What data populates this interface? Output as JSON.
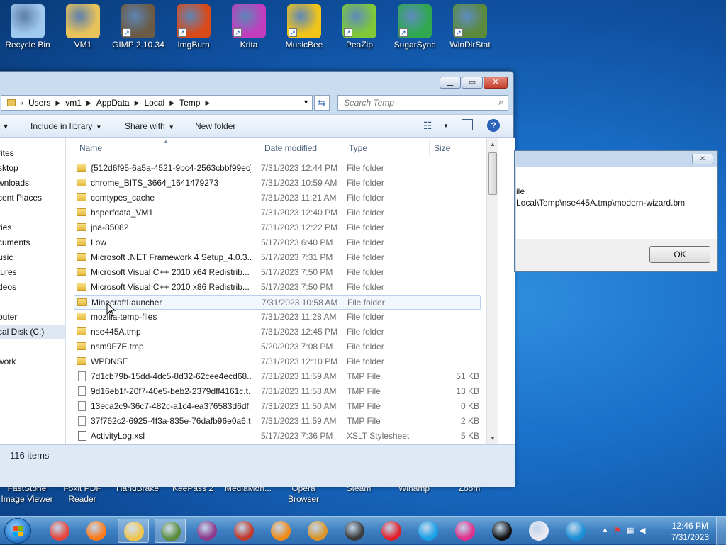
{
  "desktop": {
    "top_icons": [
      {
        "label": "Recycle Bin",
        "icon": "recycle-bin-icon",
        "color": "#9fc9ef"
      },
      {
        "label": "VM1",
        "icon": "user-folder-icon",
        "color": "#e8c25a"
      },
      {
        "label": "GIMP 2.10.34",
        "icon": "gimp-icon",
        "color": "#6b5b45"
      },
      {
        "label": "ImgBurn",
        "icon": "imgburn-icon",
        "color": "#d94a1a"
      },
      {
        "label": "Krita",
        "icon": "krita-icon",
        "color": "#c13dbd"
      },
      {
        "label": "MusicBee",
        "icon": "musicbee-icon",
        "color": "#f0c419"
      },
      {
        "label": "PeaZip",
        "icon": "peazip-icon",
        "color": "#7ec83a"
      },
      {
        "label": "SugarSync",
        "icon": "sugarsync-icon",
        "color": "#2fa84f"
      },
      {
        "label": "WinDirStat",
        "icon": "windirstat-icon",
        "color": "#5a8a3a"
      }
    ],
    "bottom_icons": [
      {
        "label": "FastStone Image Viewer"
      },
      {
        "label": "Foxit PDF Reader"
      },
      {
        "label": "HandBrake"
      },
      {
        "label": "KeePass 2"
      },
      {
        "label": "MediaMon..."
      },
      {
        "label": "Opera Browser"
      },
      {
        "label": "Steam"
      },
      {
        "label": "Winamp"
      },
      {
        "label": "Zoom"
      }
    ]
  },
  "explorer": {
    "breadcrumbs": [
      "Users",
      "vm1",
      "AppData",
      "Local",
      "Temp"
    ],
    "breadcrumb_prefix": "«",
    "search_placeholder": "Search Temp",
    "toolbar": {
      "include_in_library": "Include in library",
      "share_with": "Share with",
      "new_folder": "New folder"
    },
    "nav_items": [
      {
        "label": "rites",
        "selected": false
      },
      {
        "label": "sktop",
        "selected": false
      },
      {
        "label": "wnloads",
        "selected": false
      },
      {
        "label": "cent Places",
        "selected": false
      },
      {
        "label": "ries",
        "selected": false
      },
      {
        "label": "cuments",
        "selected": false
      },
      {
        "label": "usic",
        "selected": false
      },
      {
        "label": "tures",
        "selected": false
      },
      {
        "label": "deos",
        "selected": false
      },
      {
        "label": "puter",
        "selected": false
      },
      {
        "label": "cal Disk (C:)",
        "selected": true
      },
      {
        "label": "work",
        "selected": false
      }
    ],
    "columns": {
      "name": "Name",
      "date": "Date modified",
      "type": "Type",
      "size": "Size"
    },
    "files": [
      {
        "name": "{512d6f95-6a5a-4521-9bc4-2563cbbf99ec}",
        "date": "7/31/2023 12:44 PM",
        "type": "File folder",
        "size": "",
        "kind": "folder"
      },
      {
        "name": "chrome_BITS_3664_1641479273",
        "date": "7/31/2023 10:59 AM",
        "type": "File folder",
        "size": "",
        "kind": "folder"
      },
      {
        "name": "comtypes_cache",
        "date": "7/31/2023 11:21 AM",
        "type": "File folder",
        "size": "",
        "kind": "folder"
      },
      {
        "name": "hsperfdata_VM1",
        "date": "7/31/2023 12:40 PM",
        "type": "File folder",
        "size": "",
        "kind": "folder"
      },
      {
        "name": "jna-85082",
        "date": "7/31/2023 12:22 PM",
        "type": "File folder",
        "size": "",
        "kind": "folder"
      },
      {
        "name": "Low",
        "date": "5/17/2023 6:40 PM",
        "type": "File folder",
        "size": "",
        "kind": "folder"
      },
      {
        "name": "Microsoft .NET Framework 4 Setup_4.0.3...",
        "date": "5/17/2023 7:31 PM",
        "type": "File folder",
        "size": "",
        "kind": "folder"
      },
      {
        "name": "Microsoft Visual C++ 2010  x64 Redistrib...",
        "date": "5/17/2023 7:50 PM",
        "type": "File folder",
        "size": "",
        "kind": "folder"
      },
      {
        "name": "Microsoft Visual C++ 2010  x86 Redistrib...",
        "date": "5/17/2023 7:50 PM",
        "type": "File folder",
        "size": "",
        "kind": "folder"
      },
      {
        "name": "MinecraftLauncher",
        "date": "7/31/2023 10:58 AM",
        "type": "File folder",
        "size": "",
        "kind": "folder",
        "hover": true
      },
      {
        "name": "mozilla-temp-files",
        "date": "7/31/2023 11:28 AM",
        "type": "File folder",
        "size": "",
        "kind": "folder"
      },
      {
        "name": "nse445A.tmp",
        "date": "7/31/2023 12:45 PM",
        "type": "File folder",
        "size": "",
        "kind": "folder"
      },
      {
        "name": "nsm9F7E.tmp",
        "date": "5/20/2023 7:08 PM",
        "type": "File folder",
        "size": "",
        "kind": "folder"
      },
      {
        "name": "WPDNSE",
        "date": "7/31/2023 12:10 PM",
        "type": "File folder",
        "size": "",
        "kind": "folder"
      },
      {
        "name": "7d1cb79b-15dd-4dc5-8d32-62cee4ecd68...",
        "date": "7/31/2023 11:59 AM",
        "type": "TMP File",
        "size": "51 KB",
        "kind": "file"
      },
      {
        "name": "9d16eb1f-20f7-40e5-beb2-2379dff4161c.t...",
        "date": "7/31/2023 11:58 AM",
        "type": "TMP File",
        "size": "13 KB",
        "kind": "file"
      },
      {
        "name": "13eca2c9-36c7-482c-a1c4-ea376583d6df....",
        "date": "7/31/2023 11:50 AM",
        "type": "TMP File",
        "size": "0 KB",
        "kind": "file"
      },
      {
        "name": "37f762c2-6925-4f3a-835e-76dafb96e0a6.t...",
        "date": "7/31/2023 11:59 AM",
        "type": "TMP File",
        "size": "2 KB",
        "kind": "file"
      },
      {
        "name": "ActivityLog.xsl",
        "date": "5/17/2023 7:36 PM",
        "type": "XSLT Stylesheet",
        "size": "5 KB",
        "kind": "xsl"
      }
    ],
    "status": "116 items"
  },
  "dialog": {
    "line1": "ile",
    "line2": "Local\\Temp\\nse445A.tmp\\modern-wizard.bm",
    "ok": "OK"
  },
  "taskbar": {
    "apps": [
      {
        "icon": "chrome-icon",
        "color": "#e8453c"
      },
      {
        "icon": "firefox-icon",
        "color": "#ff7a1a"
      },
      {
        "icon": "explorer-icon",
        "color": "#f0c44c",
        "active": true
      },
      {
        "icon": "windirstat-icon",
        "color": "#5a8a3a",
        "active": true
      },
      {
        "icon": "winrar-icon",
        "color": "#8c3a8a"
      },
      {
        "icon": "app-32-icon",
        "color": "#c0392b"
      },
      {
        "icon": "vlc-icon",
        "color": "#f08a1a"
      },
      {
        "icon": "eye-app-icon",
        "color": "#d9952a"
      },
      {
        "icon": "bee-icon",
        "color": "#3a3a3a"
      },
      {
        "icon": "opera-icon",
        "color": "#e0202c"
      },
      {
        "icon": "skype-icon",
        "color": "#1aa0e8"
      },
      {
        "icon": "headphones-icon",
        "color": "#e0308c"
      },
      {
        "icon": "record-icon",
        "color": "#111111"
      },
      {
        "icon": "itunes-icon",
        "color": "#e9e9f3"
      },
      {
        "icon": "edge-icon",
        "color": "#1b8fd6"
      }
    ],
    "time": "12:46 PM",
    "date": "7/31/2023"
  }
}
